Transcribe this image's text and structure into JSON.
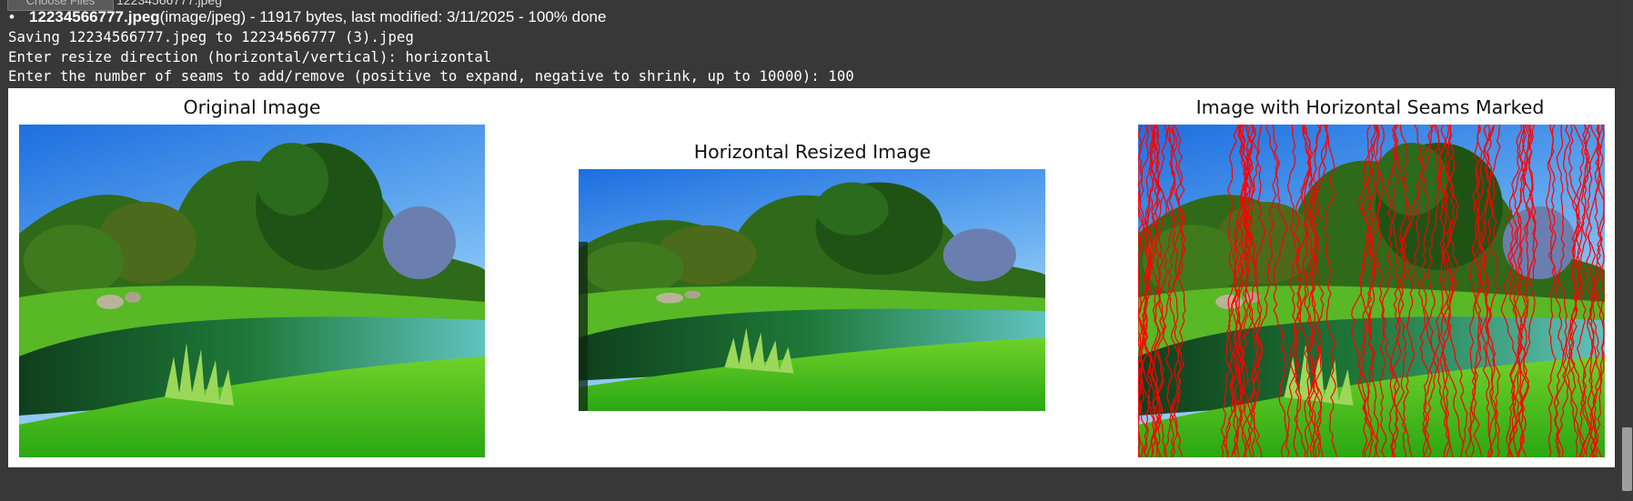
{
  "file_input": {
    "button_label": "Choose Files",
    "chosen_file": "12234566777.jpeg"
  },
  "upload": {
    "filename": "12234566777.jpeg",
    "details": "(image/jpeg) - 11917 bytes, last modified: 3/11/2025 - 100% done"
  },
  "log_lines": [
    "Saving 12234566777.jpeg to 12234566777 (3).jpeg",
    "Enter resize direction (horizontal/vertical): horizontal",
    "Enter the number of seams to add/remove (positive to expand, negative to shrink, up to 10000): 100"
  ],
  "figure": {
    "subplots": [
      {
        "title": "Original Image"
      },
      {
        "title": "Horizontal Resized Image"
      },
      {
        "title": "Image with Horizontal Seams Marked"
      }
    ]
  },
  "colors": {
    "background": "#383838",
    "seam": "#ff0000",
    "sky": "#2f7fe0",
    "grass": "#3fbf1c"
  }
}
